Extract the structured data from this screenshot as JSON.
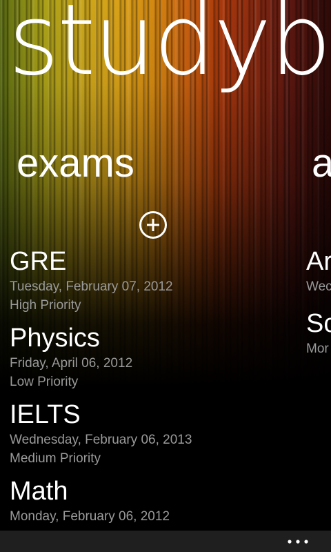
{
  "app": {
    "title": "studyb"
  },
  "pivot": {
    "active_header": "exams",
    "next_header": "a"
  },
  "exams": {
    "add_icon": "add-circle-icon",
    "items": [
      {
        "title": "GRE",
        "date": "Tuesday, February 07, 2012",
        "priority": "High Priority"
      },
      {
        "title": "Physics",
        "date": "Friday, April 06, 2012",
        "priority": "Low Priority"
      },
      {
        "title": "IELTS",
        "date": "Wednesday, February 06, 2013",
        "priority": "Medium Priority"
      },
      {
        "title": "Math",
        "date": "Monday, February 06, 2012",
        "priority": ""
      }
    ]
  },
  "peek": {
    "items": [
      {
        "title": "Ar",
        "sub": "Wec"
      },
      {
        "title": "Sc",
        "sub": "Mor"
      }
    ]
  },
  "app_bar": {
    "more_icon": "ellipsis-icon"
  },
  "colors": {
    "background": "#000000",
    "text": "#ffffff",
    "subtext": "#9a9a9a",
    "app_bar": "#1f1f1f"
  }
}
